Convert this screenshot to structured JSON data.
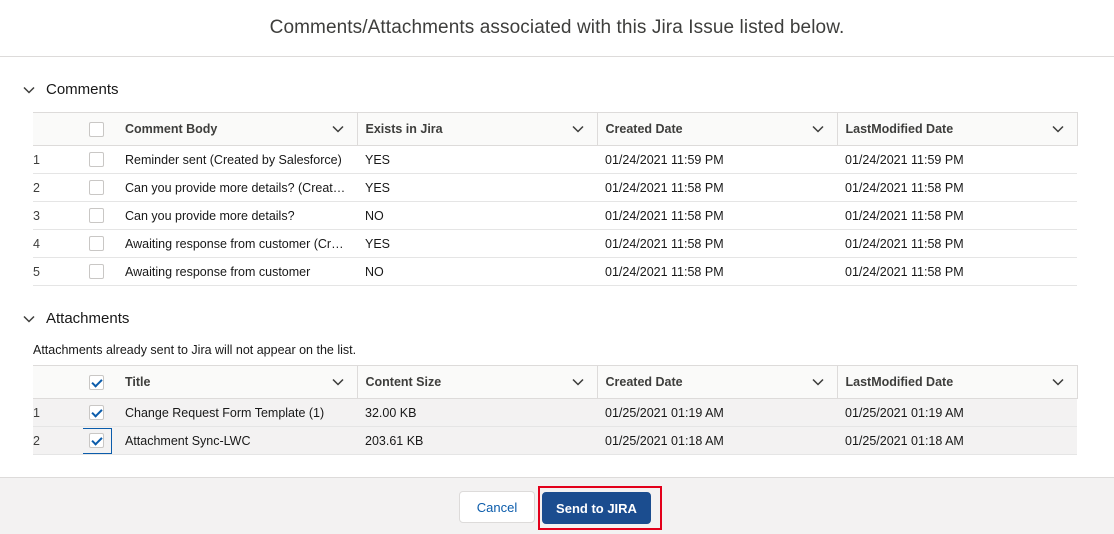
{
  "header": {
    "title": "Comments/Attachments associated with this Jira Issue listed below."
  },
  "comments": {
    "section_label": "Comments",
    "columns": [
      "Comment Body",
      "Exists in Jira",
      "Created Date",
      "LastModified Date"
    ],
    "rows": [
      {
        "num": "1",
        "body": "Reminder sent (Created by Salesforce)",
        "exists": "YES",
        "created": "01/24/2021 11:59 PM",
        "modified": "01/24/2021 11:59 PM"
      },
      {
        "num": "2",
        "body": "Can you provide more details? (Created by Salesforce)",
        "exists": "YES",
        "created": "01/24/2021 11:58 PM",
        "modified": "01/24/2021 11:58 PM"
      },
      {
        "num": "3",
        "body": "Can you provide more details?",
        "exists": "NO",
        "created": "01/24/2021 11:58 PM",
        "modified": "01/24/2021 11:58 PM"
      },
      {
        "num": "4",
        "body": "Awaiting response from customer (Created by Salesforce)",
        "exists": "YES",
        "created": "01/24/2021 11:58 PM",
        "modified": "01/24/2021 11:58 PM"
      },
      {
        "num": "5",
        "body": "Awaiting response from customer",
        "exists": "NO",
        "created": "01/24/2021 11:58 PM",
        "modified": "01/24/2021 11:58 PM"
      }
    ]
  },
  "attachments": {
    "section_label": "Attachments",
    "hint": "Attachments already sent to Jira will not appear on the list.",
    "columns": [
      "Title",
      "Content Size",
      "Created Date",
      "LastModified Date"
    ],
    "rows": [
      {
        "num": "1",
        "title": "Change Request Form Template (1)",
        "size": "32.00 KB",
        "created": "01/25/2021 01:19 AM",
        "modified": "01/25/2021 01:19 AM"
      },
      {
        "num": "2",
        "title": "Attachment Sync-LWC",
        "size": "203.61 KB",
        "created": "01/25/2021 01:18 AM",
        "modified": "01/25/2021 01:18 AM"
      }
    ]
  },
  "footer": {
    "cancel_label": "Cancel",
    "send_label": "Send to JIRA"
  },
  "colors": {
    "brand": "#1b4d8f",
    "link": "#0b5cab",
    "highlight": "#e3001b"
  },
  "icons": {
    "section": "chevron-down-icon",
    "column_menu": "chevron-down-icon",
    "check": "check-icon"
  }
}
